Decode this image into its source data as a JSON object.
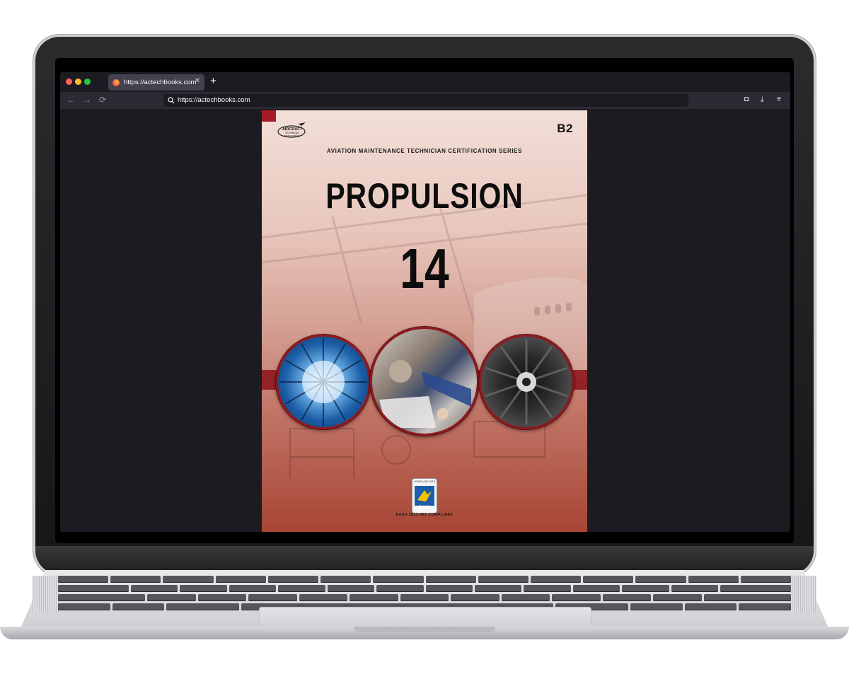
{
  "browser": {
    "tab": {
      "title": "https://actechbooks.com",
      "close_icon": "close-icon"
    },
    "new_tab_label": "+",
    "urlbar": {
      "url": "https://actechbooks.com"
    },
    "nav": {
      "back": "←",
      "forward": "→",
      "reload": "⟳"
    },
    "toolbar": {
      "pocket": "◘",
      "downloads": "⤓",
      "menu": "≡"
    },
    "traffic_light_colors": [
      "#ff5f57",
      "#febc2e",
      "#28c840"
    ]
  },
  "cover": {
    "edition_label": "B2",
    "series": "AVIATION MAINTENANCE TECHNICIAN CERTIFICATION SERIES",
    "title": "PROPULSION",
    "module_number": "14",
    "publisher_logo_text": [
      "AIRCRAFT",
      "TECHNICAL",
      "BOOK COMPANY"
    ],
    "easa_badge": {
      "top": "COMPLIANT WITH",
      "label": "EASA",
      "sub": "EASA PART 66"
    },
    "compliance": "EASA 2023-989 COMPLIANT",
    "colors": {
      "accent_red": "#a31c23",
      "title": "#0d0d0d"
    }
  }
}
